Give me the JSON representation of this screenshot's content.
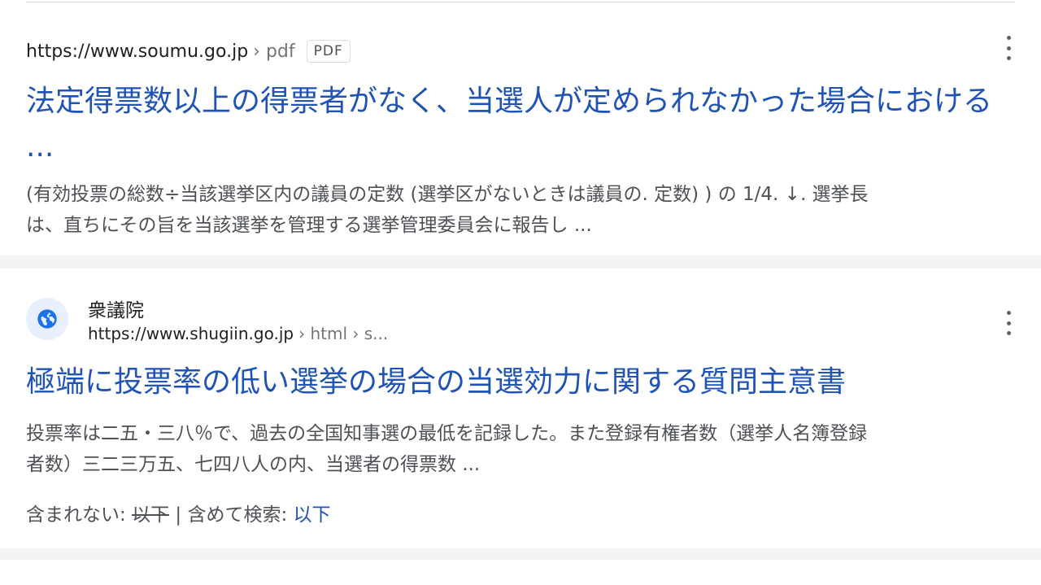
{
  "results": [
    {
      "url": "https://www.soumu.go.jp",
      "breadcrumb": "› pdf",
      "file_badge": "PDF",
      "title": "法定得票数以上の得票者がなく、当選人が定められなかった場合における ...",
      "snippet_line1": "(有効投票の総数÷当該選挙区内の議員の定数 (選挙区がないときは議員の. 定数) ) の 1/4. ↓. 選挙長",
      "snippet_line2": "は、直ちにその旨を当該選挙を管理する選挙管理委員会に報告し ...",
      "more_icon": "more-vert-icon"
    },
    {
      "site_name": "衆議院",
      "site_icon": "globe-icon",
      "url": "https://www.shugiin.go.jp",
      "breadcrumb": "› html › s...",
      "title": "極端に投票率の低い選挙の場合の当選効力に関する質問主意書",
      "snippet_line1": "投票率は二五・三八％で、過去の全国知事選の最低を記録した。また登録有権者数（選挙人名簿登録",
      "snippet_line2": "者数）三二三万五、七四八人の内、当選者の得票数 ...",
      "missing_label": "含まれない:",
      "missing_term": "以下",
      "separator": "|",
      "search_with_label": "含めて検索:",
      "search_with_term": "以下",
      "more_icon": "more-vert-icon"
    }
  ],
  "colors": {
    "link": "#1f53b5",
    "snippet": "#4d5156",
    "url": "#202124",
    "breadcrumb": "#70757a",
    "separator_band": "#f1f3f4",
    "globe": "#1a73e8",
    "globe_bg": "#e8f0fe"
  }
}
